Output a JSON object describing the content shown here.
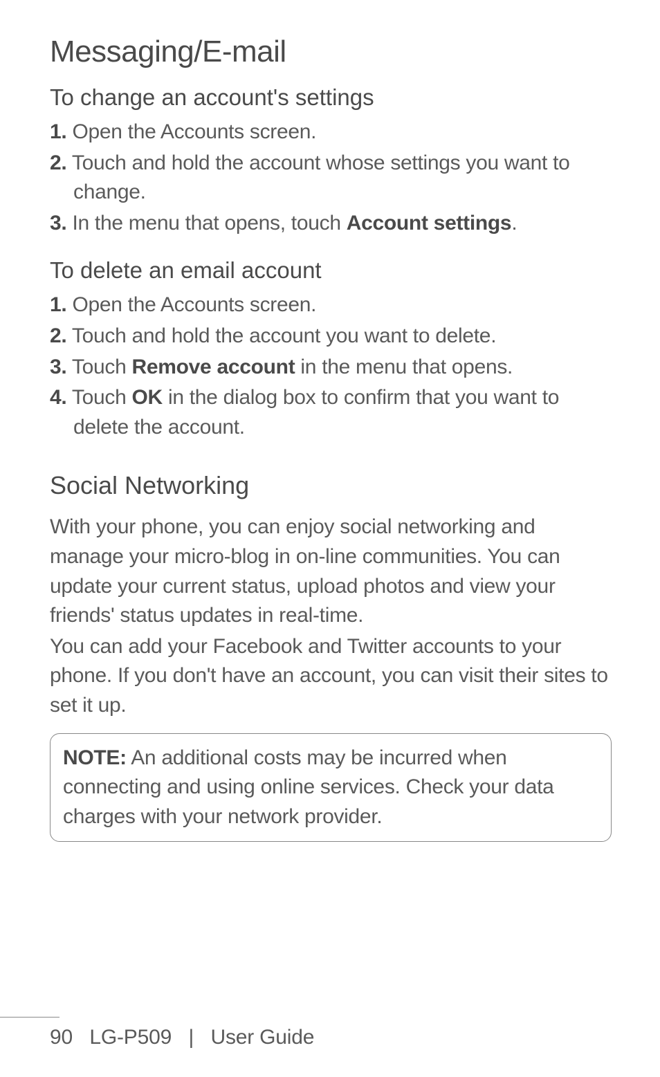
{
  "page_title": "Messaging/E-mail",
  "sections": [
    {
      "heading": "To change an account's settings",
      "steps": [
        {
          "num": "1.",
          "text": " Open the Accounts screen."
        },
        {
          "num": "2.",
          "text": " Touch and hold the account whose settings you want to change."
        },
        {
          "num": "3.",
          "text_before": " In the menu that opens, touch ",
          "bold": "Account settings",
          "text_after": "."
        }
      ]
    },
    {
      "heading": "To delete an email account",
      "steps": [
        {
          "num": "1.",
          "text": " Open the Accounts screen."
        },
        {
          "num": "2.",
          "text": " Touch and hold the account you want to delete."
        },
        {
          "num": "3.",
          "text_before": " Touch ",
          "bold": "Remove account",
          "text_after": " in the menu that opens."
        },
        {
          "num": "4.",
          "text_before": " Touch ",
          "bold": "OK",
          "text_after": " in the dialog box to confirm that you want to delete the account."
        }
      ]
    }
  ],
  "social": {
    "title": "Social Networking",
    "para1": "With your phone, you can enjoy social networking and manage your micro-blog in on-line communities. You can update your current status, upload photos and view your friends' status updates in real-time.",
    "para2": "You can add your Facebook and Twitter accounts to your phone. If you don't have an account, you can visit their sites to set it up."
  },
  "note": {
    "label": "NOTE:",
    "text": " An additional costs may be incurred when connecting and using online services. Check your data charges with your network provider."
  },
  "footer": {
    "page_num": "90",
    "model": "LG-P509",
    "divider": "|",
    "guide": "User Guide"
  }
}
